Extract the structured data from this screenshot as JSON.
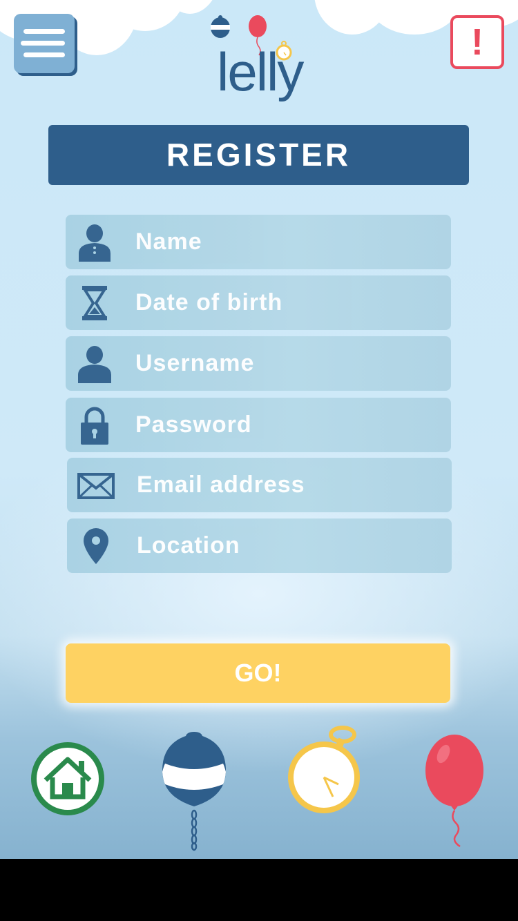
{
  "header": {
    "logo_text": "lelly",
    "menu_icon": "menu-icon",
    "alert_label": "!"
  },
  "form": {
    "title": "REGISTER",
    "fields": [
      {
        "icon": "person-tie-icon",
        "placeholder": "Name"
      },
      {
        "icon": "hourglass-icon",
        "placeholder": "Date of birth"
      },
      {
        "icon": "user-icon",
        "placeholder": "Username"
      },
      {
        "icon": "lock-icon",
        "placeholder": "Password"
      },
      {
        "icon": "envelope-icon",
        "placeholder": "Email address"
      },
      {
        "icon": "location-pin-icon",
        "placeholder": "Location"
      }
    ],
    "submit_label": "GO!"
  },
  "bottom_nav": [
    {
      "icon": "home-icon"
    },
    {
      "icon": "buoy-icon"
    },
    {
      "icon": "stopwatch-icon"
    },
    {
      "icon": "balloon-icon"
    }
  ],
  "colors": {
    "primary": "#2e5e8b",
    "alert": "#ea4a5d",
    "go_button": "#fed262",
    "home_green": "#2a8a4c",
    "field_bg": "#a9d2e4"
  }
}
